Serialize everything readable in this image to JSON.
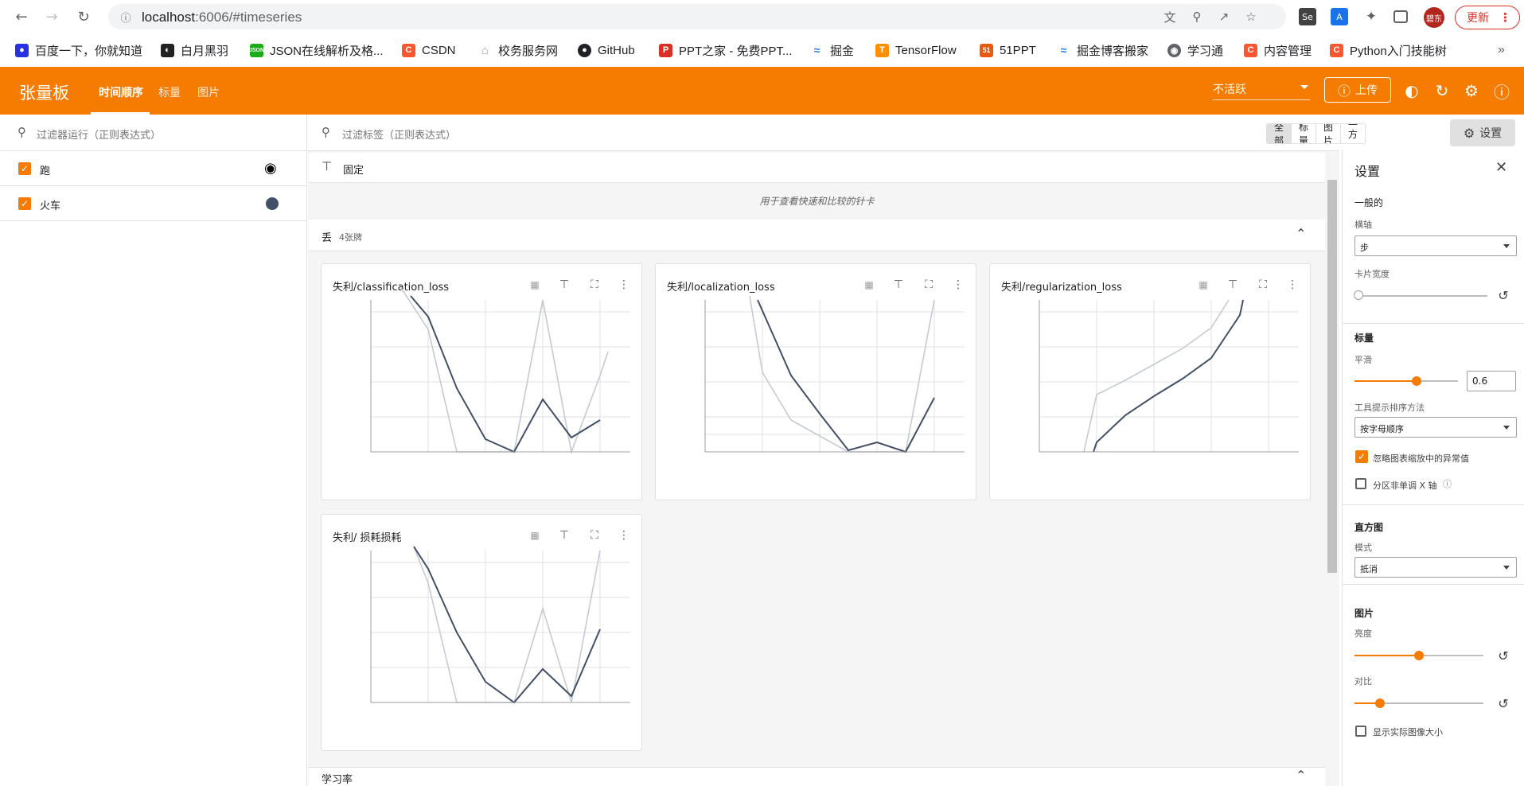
{
  "browser": {
    "url_host": "localhost",
    "url_path": ":6006/#timeseries",
    "profile_label": "碧东",
    "update_label": "更新"
  },
  "bookmarks": [
    {
      "label": "百度一下，你就知道",
      "icon": "baidu-icon",
      "color": "#2932e1"
    },
    {
      "label": "白月黑羽",
      "icon": "baiyue-icon",
      "color": "#222222"
    },
    {
      "label": "JSON在线解析及格...",
      "icon": "json-icon",
      "color": "#1aad19"
    },
    {
      "label": "CSDN",
      "icon": "csdn-icon",
      "color": "#fc5531"
    },
    {
      "label": "校务服务网",
      "icon": "house-icon",
      "color": "#9aa0a6"
    },
    {
      "label": "GitHub",
      "icon": "github-icon",
      "color": "#202124"
    },
    {
      "label": "PPT之家 - 免费PPT...",
      "icon": "ppt-icon",
      "color": "#d93025"
    },
    {
      "label": "掘金",
      "icon": "juejin-icon",
      "color": "#1e80ff"
    },
    {
      "label": "TensorFlow",
      "icon": "tensorflow-icon",
      "color": "#ff8f00"
    },
    {
      "label": "51PPT",
      "icon": "51ppt-icon",
      "color": "#e8590c"
    },
    {
      "label": "掘金博客搬家",
      "icon": "juejin-icon",
      "color": "#1e80ff"
    },
    {
      "label": "学习通",
      "icon": "globe-icon",
      "color": "#5f6368"
    },
    {
      "label": "内容管理",
      "icon": "csdn-icon",
      "color": "#fc5531"
    },
    {
      "label": "Python入门技能树",
      "icon": "csdn-icon",
      "color": "#fc5531"
    }
  ],
  "header": {
    "brand": "张量板",
    "tabs": [
      {
        "label": "时间顺序",
        "active": true
      },
      {
        "label": "标量",
        "active": false
      },
      {
        "label": "图片",
        "active": false
      }
    ],
    "inactive_label": "不活跃",
    "upload_label": "上传",
    "accent": "#f57c00"
  },
  "runs": {
    "filter_placeholder": "过滤器运行（正则表达式）",
    "items": [
      {
        "label": "跑",
        "checked": true,
        "color_icon": "palette-icon"
      },
      {
        "label": "火车",
        "checked": true,
        "color": "#425066"
      }
    ]
  },
  "main": {
    "tag_filter_placeholder": "过滤标签（正则表达式）",
    "type_buttons": [
      "全部",
      "标量",
      "图片",
      "直方图"
    ],
    "settings_label": "设置",
    "pinned_label": "固定",
    "pinned_empty": "用于查看快速和比较的针卡",
    "group_label": "丢",
    "group_count": "4张牌",
    "next_group_label": "学习率"
  },
  "cards": [
    {
      "title": "失利/classification_loss"
    },
    {
      "title": "失利/localization_loss"
    },
    {
      "title": "失利/regularization_loss"
    },
    {
      "title": "失利/ 损耗损耗"
    }
  ],
  "settings": {
    "title": "设置",
    "general_h": "一般的",
    "xaxis_label": "横轴",
    "xaxis_value": "步",
    "card_width_label": "卡片宽度",
    "card_width_level": 0,
    "scalar_h": "标量",
    "smoothing_label": "平滑",
    "smoothing_value": "0.6",
    "tooltip_sort_label": "工具提示排序方法",
    "tooltip_sort_value": "按字母顺序",
    "ignore_outliers_label": "忽略图表缩放中的异常值",
    "ignore_outliers_checked": true,
    "partition_label": "分区非单调 X 轴",
    "partition_checked": false,
    "histogram_h": "直方图",
    "mode_label": "模式",
    "mode_value": "抵消",
    "image_h": "图片",
    "brightness_label": "亮度",
    "brightness_level": 0.5,
    "contrast_label": "对比",
    "contrast_level": 0.2,
    "actual_size_label": "显示实际图像大小",
    "actual_size_checked": false
  }
}
